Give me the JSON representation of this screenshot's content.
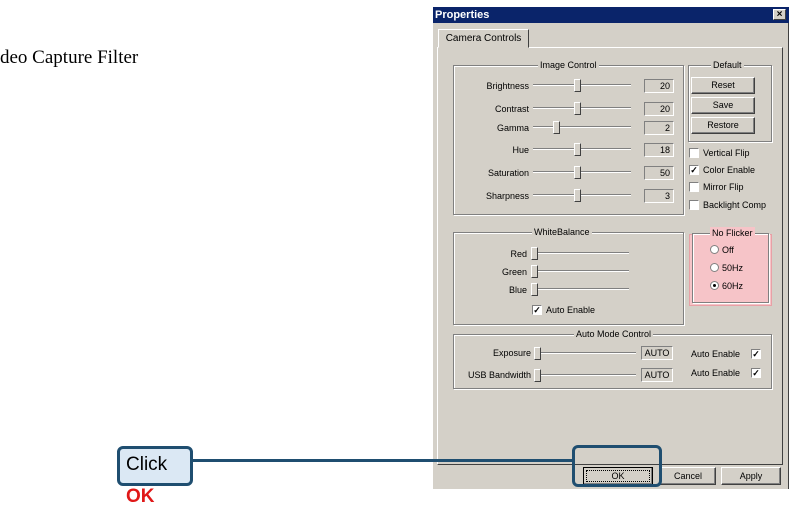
{
  "background_text": "deo Capture Filter",
  "dialog": {
    "title": "Properties",
    "close_glyph": "×",
    "tab": "Camera Controls",
    "image_control": {
      "title": "Image Control",
      "rows": [
        {
          "label": "Brightness",
          "value": "20",
          "level": 0.45
        },
        {
          "label": "Contrast",
          "value": "20",
          "level": 0.45
        },
        {
          "label": "Gamma",
          "value": "2",
          "level": 0.22
        },
        {
          "label": "Hue",
          "value": "18",
          "level": 0.45
        },
        {
          "label": "Saturation",
          "value": "50",
          "level": 0.45
        },
        {
          "label": "Sharpness",
          "value": "3",
          "level": 0.45
        }
      ]
    },
    "default": {
      "title": "Default",
      "reset": "Reset",
      "save": "Save",
      "restore": "Restore"
    },
    "options": {
      "vertical_flip": "Vertical Flip",
      "color_enable": "Color Enable",
      "mirror_flip": "Mirror Flip",
      "backlight_comp": "Backlight Comp",
      "checked_mark": "✓"
    },
    "white_balance": {
      "title": "WhiteBalance",
      "red": "Red",
      "green": "Green",
      "blue": "Blue",
      "auto_enable": "Auto Enable"
    },
    "no_flicker": {
      "title": "No Flicker",
      "off": "Off",
      "hz50": "50Hz",
      "hz60": "60Hz",
      "selected": "60Hz",
      "highlight_color": "#f6c4c8"
    },
    "auto_mode": {
      "title": "Auto Mode Control",
      "exposure": "Exposure",
      "exposure_value": "AUTO",
      "usb_bandwidth": "USB Bandwidth",
      "usb_value": "AUTO",
      "auto_enable_1": "Auto Enable",
      "auto_enable_2": "Auto Enable"
    },
    "buttons": {
      "ok": "OK",
      "cancel": "Cancel",
      "apply": "Apply"
    }
  },
  "callout": {
    "prefix": "Click ",
    "emphasis": "OK",
    "border_color": "#1f4e70",
    "emphasis_color": "#e01818"
  }
}
